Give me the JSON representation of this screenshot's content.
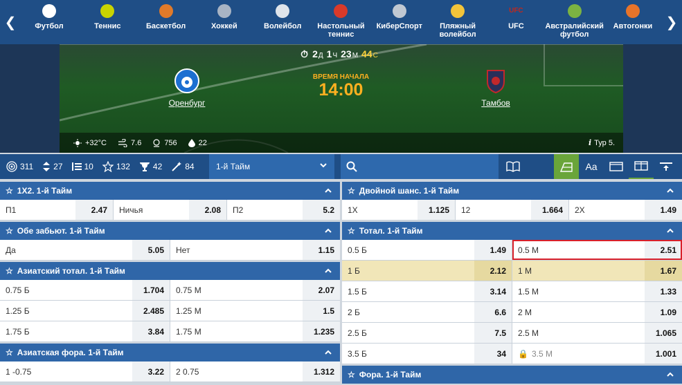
{
  "nav": {
    "sports": [
      {
        "label": "Футбол",
        "icon": "soccer-ball-icon",
        "color": "#ffffff"
      },
      {
        "label": "Теннис",
        "icon": "tennis-ball-icon",
        "color": "#c8d400"
      },
      {
        "label": "Баскетбол",
        "icon": "basketball-icon",
        "color": "#e07a2a"
      },
      {
        "label": "Хоккей",
        "icon": "hockey-skate-icon",
        "color": "#a8b4c4"
      },
      {
        "label": "Волейбол",
        "icon": "volleyball-icon",
        "color": "#dfe4ea"
      },
      {
        "label": "Настольный теннис",
        "icon": "table-tennis-icon",
        "color": "#d93a2a"
      },
      {
        "label": "КиберСпорт",
        "icon": "gamepad-icon",
        "color": "#c0c8d2"
      },
      {
        "label": "Пляжный волейбол",
        "icon": "beach-volleyball-icon",
        "color": "#f2c43a"
      },
      {
        "label": "UFC",
        "icon": "ufc-icon",
        "color": "#c0281e",
        "mark": "UFC"
      },
      {
        "label": "Австралийский футбол",
        "icon": "aussie-football-icon",
        "color": "#7cb342"
      },
      {
        "label": "Автогонки",
        "icon": "racing-helmet-icon",
        "color": "#e8742a"
      }
    ]
  },
  "match": {
    "timer": {
      "d": "2",
      "d_unit": "Д",
      "h": "1",
      "h_unit": "Ч",
      "m": "23",
      "m_unit": "М",
      "s": "44",
      "s_unit": "С"
    },
    "start_label": "ВРЕМЯ НАЧАЛА",
    "start_time": "14:00",
    "home": "Оренбург",
    "away": "Тамбов",
    "weather": {
      "temp": "+32°C",
      "wind": "7.6",
      "pressure": "756",
      "humidity": "22"
    },
    "tour": "Тур 5."
  },
  "filters": {
    "all": "311",
    "updown": "27",
    "list": "10",
    "star": "132",
    "trophy": "42",
    "wand": "84",
    "period": "1-й Тайм"
  },
  "left": [
    {
      "title": "1X2. 1-й Тайм",
      "rows": [
        [
          {
            "l": "П1",
            "o": "2.47"
          },
          {
            "l": "Ничья",
            "o": "2.08"
          },
          {
            "l": "П2",
            "o": "5.2"
          }
        ]
      ]
    },
    {
      "title": "Обе забьют. 1-й Тайм",
      "rows": [
        [
          {
            "l": "Да",
            "o": "5.05"
          },
          {
            "l": "Нет",
            "o": "1.15"
          }
        ]
      ]
    },
    {
      "title": "Азиатский тотал. 1-й Тайм",
      "rows": [
        [
          {
            "l": "0.75 Б",
            "o": "1.704"
          },
          {
            "l": "0.75 М",
            "o": "2.07"
          }
        ],
        [
          {
            "l": "1.25 Б",
            "o": "2.485"
          },
          {
            "l": "1.25 М",
            "o": "1.5"
          }
        ],
        [
          {
            "l": "1.75 Б",
            "o": "3.84"
          },
          {
            "l": "1.75 М",
            "o": "1.235"
          }
        ]
      ]
    },
    {
      "title": "Азиатская фора. 1-й Тайм",
      "rows": [
        [
          {
            "l": "1 -0.75",
            "o": "3.22"
          },
          {
            "l": "2 0.75",
            "o": "1.312"
          }
        ]
      ]
    }
  ],
  "right": [
    {
      "title": "Двойной шанс. 1-й Тайм",
      "rows": [
        [
          {
            "l": "1X",
            "o": "1.125"
          },
          {
            "l": "12",
            "o": "1.664"
          },
          {
            "l": "2X",
            "o": "1.49"
          }
        ]
      ]
    },
    {
      "title": "Тотал. 1-й Тайм",
      "rows": [
        [
          {
            "l": "0.5 Б",
            "o": "1.49"
          },
          {
            "l": "0.5 М",
            "o": "2.51",
            "sel": true
          }
        ],
        [
          {
            "l": "1 Б",
            "o": "2.12"
          },
          {
            "l": "1 М",
            "o": "1.67"
          }
        ],
        [
          {
            "l": "1.5 Б",
            "o": "3.14"
          },
          {
            "l": "1.5 М",
            "o": "1.33"
          }
        ],
        [
          {
            "l": "2 Б",
            "o": "6.6"
          },
          {
            "l": "2 М",
            "o": "1.09"
          }
        ],
        [
          {
            "l": "2.5 Б",
            "o": "7.5"
          },
          {
            "l": "2.5 М",
            "o": "1.065"
          }
        ],
        [
          {
            "l": "3.5 Б",
            "o": "34"
          },
          {
            "l": "3.5 М",
            "o": "1.001",
            "locked": true
          }
        ]
      ],
      "highlight_row": 1
    },
    {
      "title": "Фора. 1-й Тайм",
      "rows": []
    }
  ]
}
